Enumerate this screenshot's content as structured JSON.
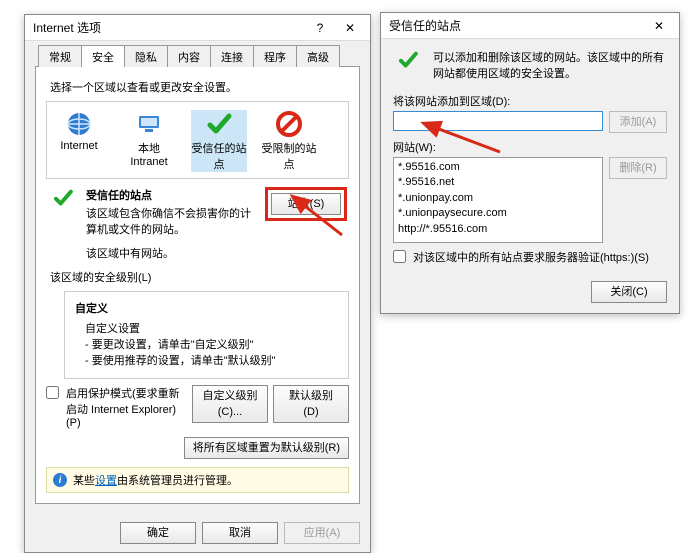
{
  "left": {
    "title": "Internet 选项",
    "tabs": [
      "常规",
      "安全",
      "隐私",
      "内容",
      "连接",
      "程序",
      "高级"
    ],
    "active_tab_index": 1,
    "prompt": "选择一个区域以查看或更改安全设置。",
    "zones": [
      {
        "label": "Internet",
        "icon": "globe"
      },
      {
        "label": "本地 Intranet",
        "icon": "house"
      },
      {
        "label": "受信任的站点",
        "icon": "check",
        "selected": true
      },
      {
        "label": "受限制的站点",
        "icon": "nope"
      }
    ],
    "zone_desc_title": "受信任的站点",
    "zone_desc_body": "该区域包含你确信不会损害你的计算机或文件的网站。",
    "zone_desc_note": "该区域中有网站。",
    "sites_btn": "站点(S)",
    "level_label": "该区域的安全级别(L)",
    "level": {
      "title": "自定义",
      "line1": "自定义设置",
      "line2": "- 要更改设置，请单击\"自定义级别\"",
      "line3": "- 要使用推荐的设置，请单击\"默认级别\""
    },
    "protected_mode": "启用保护模式(要求重新启动 Internet Explorer)(P)",
    "btn_custom_level": "自定义级别(C)...",
    "btn_default_level": "默认级别(D)",
    "btn_reset_all": "将所有区域重置为默认级别(R)",
    "info_prefix": "某些",
    "info_link": "设置",
    "info_suffix": "由系统管理员进行管理。",
    "ok": "确定",
    "cancel": "取消",
    "apply": "应用(A)"
  },
  "right": {
    "title": "受信任的站点",
    "header_text": "可以添加和删除该区域的网站。该区域中的所有网站都使用区域的安全设置。",
    "add_label": "将该网站添加到区域(D):",
    "input_value": "",
    "btn_add": "添加(A)",
    "list_label": "网站(W):",
    "sites": [
      "*.95516.com",
      "*.95516.net",
      "*.unionpay.com",
      "*.unionpaysecure.com",
      "http://*.95516.com"
    ],
    "btn_remove": "删除(R)",
    "require_https": "对该区域中的所有站点要求服务器验证(https:)(S)",
    "close": "关闭(C)"
  }
}
